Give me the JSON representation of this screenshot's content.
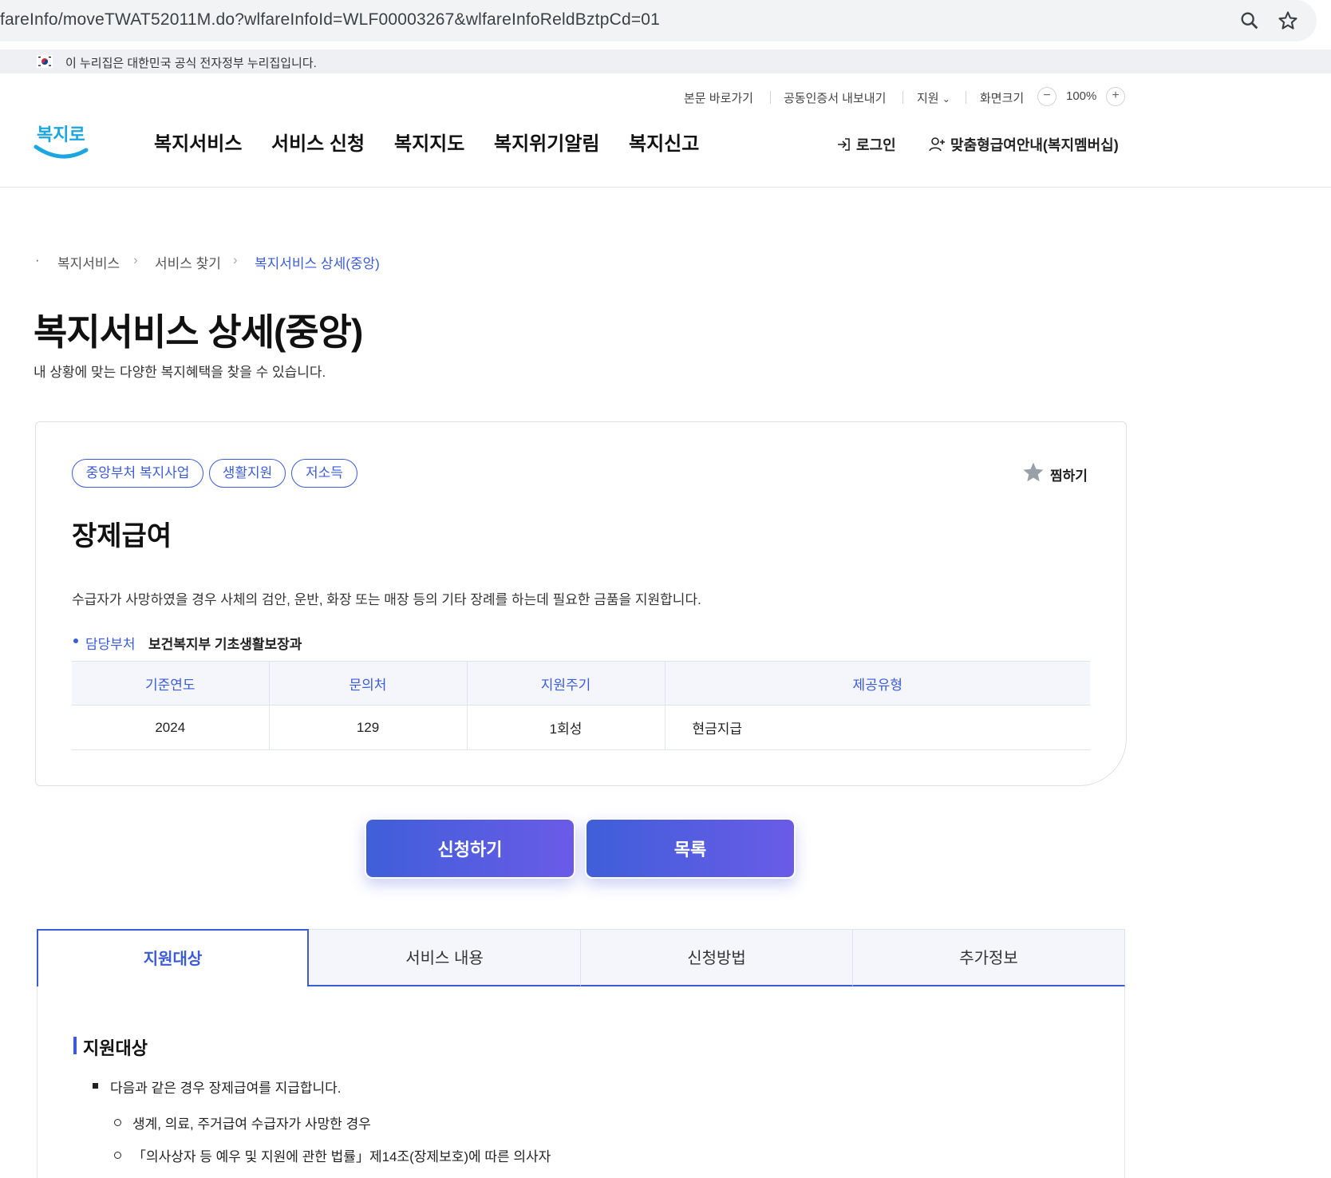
{
  "browser": {
    "url": "fareInfo/moveTWAT52011M.do?wlfareInfoId=WLF00003267&wlfareInfoReldBztpCd=01"
  },
  "gov_banner": {
    "text": "이 누리집은 대한민국 공식 전자정부 누리집입니다."
  },
  "utility": {
    "skip": "본문 바로가기",
    "cert": "공동인증서 내보내기",
    "support": "지원",
    "zoom_label": "화면크기",
    "zoom_value": "100%",
    "zoom_out": "−",
    "zoom_in": "+"
  },
  "header": {
    "logo_text": "복지로",
    "nav": [
      "복지서비스",
      "서비스 신청",
      "복지지도",
      "복지위기알림",
      "복지신고"
    ],
    "login": "로그인",
    "membership": "맞춤형급여안내(복지멤버십)"
  },
  "breadcrumb": [
    "복지서비스",
    "서비스 찾기",
    "복지서비스 상세(중앙)"
  ],
  "page": {
    "title": "복지서비스 상세(중앙)",
    "subtitle": "내 상황에 맞는 다양한 복지혜택을 찾을 수 있습니다."
  },
  "service": {
    "tags": [
      "중앙부처 복지사업",
      "생활지원",
      "저소득"
    ],
    "favorite": "찜하기",
    "title": "장제급여",
    "description": "수급자가 사망하였을 경우 사체의 검안, 운반, 화장 또는 매장 등의 기타 장례를 하는데 필요한 금품을 지원합니다.",
    "dept_label": "담당부처",
    "dept_value": "보건복지부 기초생활보장과",
    "table": {
      "headers": [
        "기준연도",
        "문의처",
        "지원주기",
        "제공유형"
      ],
      "row": [
        "2024",
        "129",
        "1회성",
        "현금지급"
      ]
    }
  },
  "buttons": {
    "apply": "신청하기",
    "list": "목록"
  },
  "tabs": [
    "지원대상",
    "서비스 내용",
    "신청방법",
    "추가정보"
  ],
  "content": {
    "section_title": "지원대상",
    "bullet": "다음과 같은 경우 장제급여를 지급합니다.",
    "sub_items": [
      "생계, 의료, 주거급여 수급자가 사망한 경우",
      "「의사상자 등 예우 및 지원에 관한 법률」제14조(장제보호)에 따른 의사자"
    ]
  },
  "colors": {
    "accent": "#3b5bdb",
    "gradient_end": "#6a5be8"
  }
}
